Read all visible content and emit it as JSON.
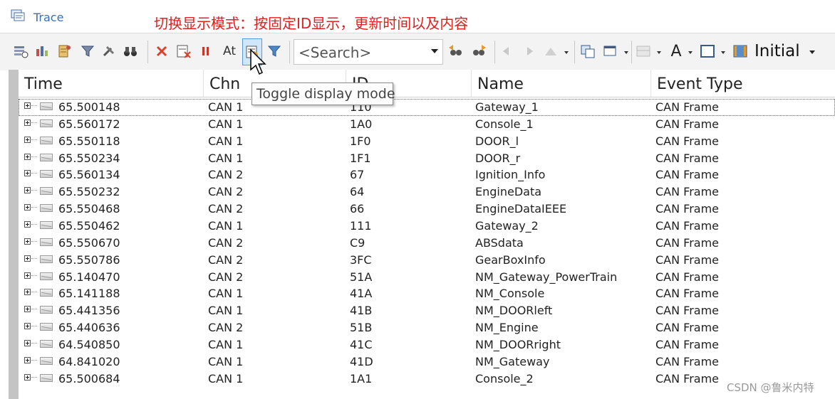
{
  "window": {
    "title": "Trace",
    "annotation": "切换显示模式：按固定ID显示，更新时间以及内容"
  },
  "toolbar": {
    "search_placeholder": "<Search>",
    "layout_label": "Initial",
    "tooltip": "Toggle display mode",
    "font_letter": "A",
    "at_label": "At",
    "binoculars": "🔭"
  },
  "columns": [
    "Time",
    "Chn",
    "ID",
    "Name",
    "Event Type"
  ],
  "rows": [
    {
      "time": "65.500148",
      "chn": "CAN 1",
      "id": "110",
      "name": "Gateway_1",
      "event": "CAN Frame"
    },
    {
      "time": "65.560172",
      "chn": "CAN 1",
      "id": "1A0",
      "name": "Console_1",
      "event": "CAN Frame"
    },
    {
      "time": "65.550118",
      "chn": "CAN 1",
      "id": "1F0",
      "name": "DOOR_l",
      "event": "CAN Frame"
    },
    {
      "time": "65.550234",
      "chn": "CAN 1",
      "id": "1F1",
      "name": "DOOR_r",
      "event": "CAN Frame"
    },
    {
      "time": "65.560134",
      "chn": "CAN 2",
      "id": "67",
      "name": "Ignition_Info",
      "event": "CAN Frame"
    },
    {
      "time": "65.550232",
      "chn": "CAN 2",
      "id": "64",
      "name": "EngineData",
      "event": "CAN Frame"
    },
    {
      "time": "65.550468",
      "chn": "CAN 2",
      "id": "66",
      "name": "EngineDataIEEE",
      "event": "CAN Frame"
    },
    {
      "time": "65.550462",
      "chn": "CAN 1",
      "id": "111",
      "name": "Gateway_2",
      "event": "CAN Frame"
    },
    {
      "time": "65.550670",
      "chn": "CAN 2",
      "id": "C9",
      "name": "ABSdata",
      "event": "CAN Frame"
    },
    {
      "time": "65.550786",
      "chn": "CAN 2",
      "id": "3FC",
      "name": "GearBoxInfo",
      "event": "CAN Frame"
    },
    {
      "time": "65.140470",
      "chn": "CAN 2",
      "id": "51A",
      "name": "NM_Gateway_PowerTrain",
      "event": "CAN Frame"
    },
    {
      "time": "65.141188",
      "chn": "CAN 1",
      "id": "41A",
      "name": "NM_Console",
      "event": "CAN Frame"
    },
    {
      "time": "65.441356",
      "chn": "CAN 1",
      "id": "41B",
      "name": "NM_DOORleft",
      "event": "CAN Frame"
    },
    {
      "time": "65.440636",
      "chn": "CAN 2",
      "id": "51B",
      "name": "NM_Engine",
      "event": "CAN Frame"
    },
    {
      "time": "64.540850",
      "chn": "CAN 1",
      "id": "41C",
      "name": "NM_DOORright",
      "event": "CAN Frame"
    },
    {
      "time": "64.841020",
      "chn": "CAN 1",
      "id": "41D",
      "name": "NM_Gateway",
      "event": "CAN Frame"
    },
    {
      "time": "65.500684",
      "chn": "CAN 1",
      "id": "1A1",
      "name": "Console_2",
      "event": "CAN Frame"
    }
  ],
  "watermark": "CSDN @鲁米内特",
  "colors": {
    "annotation": "#e02020",
    "title": "#3a6fb0",
    "active_button": "#cfe6fb"
  }
}
